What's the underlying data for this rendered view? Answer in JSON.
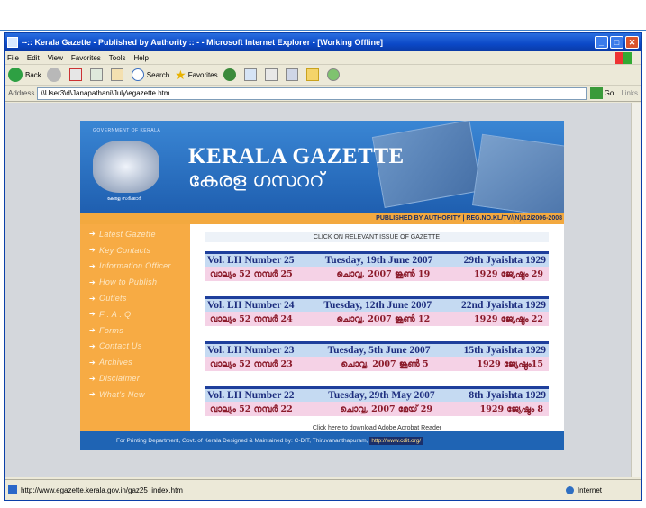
{
  "window": {
    "title": "--:: Kerala Gazette - Published by Authority :: - - Microsoft Internet Explorer - [Working Offline]"
  },
  "menu": [
    "File",
    "Edit",
    "View",
    "Favorites",
    "Tools",
    "Help"
  ],
  "toolbar": {
    "back": "Back",
    "search": "Search",
    "favorites": "Favorites"
  },
  "address": {
    "label": "Address",
    "value": "\\\\User3\\d\\Janapathani\\July\\egazette.htm",
    "go": "Go",
    "links": "Links"
  },
  "page": {
    "gov_label": "GOVERNMENT OF KERALA",
    "emblem_label": "കേരള സർക്കാർ",
    "title": "KERALA GAZETTE",
    "title_ml": "കേരള ഗസററ്",
    "published": "PUBLISHED BY AUTHORITY | REG.NO.KL/TV/(N)/12/2006-2008",
    "instruction": "CLICK ON RELEVANT ISSUE OF GAZETTE",
    "nav": [
      "Latest Gazette",
      "Key Contacts",
      "Information Officer",
      "How to Publish",
      "Outlets",
      "F . A . Q",
      "Forms",
      "Contact Us",
      "Archives",
      "Disclaimer",
      "What's New"
    ],
    "issues": [
      {
        "vol": "Vol. LII  Number 25",
        "date": "Tuesday, 19th June 2007",
        "saka": "29th Jyaishta 1929",
        "vol_ml": "വാല്യം 52 നമ്പർ 25",
        "date_ml": "ചൊവ്വ, 2007 ജൂൺ 19",
        "saka_ml": "1929 ജ്യേഷ്ഠം 29"
      },
      {
        "vol": "Vol. LII  Number 24",
        "date": "Tuesday, 12th June 2007",
        "saka": "22nd Jyaishta 1929",
        "vol_ml": "വാല്യം 52 നമ്പർ 24",
        "date_ml": "ചൊവ്വ, 2007 ജൂൺ 12",
        "saka_ml": "1929 ജ്യേഷ്ഠം 22"
      },
      {
        "vol": "Vol. LII  Number 23",
        "date": "Tuesday, 5th June 2007",
        "saka": "15th Jyaishta 1929",
        "vol_ml": "വാല്യം 52 നമ്പർ 23",
        "date_ml": "ചൊവ്വ, 2007 ജൂൺ 5",
        "saka_ml": "1929 ജ്യേഷ്ഠം15"
      },
      {
        "vol": "Vol. LII  Number 22",
        "date": "Tuesday, 29th May 2007",
        "saka": "8th Jyaishta 1929",
        "vol_ml": "വാല്യം 52 നമ്പർ 22",
        "date_ml": "ചൊവ്വ, 2007 മേയ് 29",
        "saka_ml": "1929 ജ്യേഷ്ഠം 8"
      }
    ],
    "acrobat": "Click here to download Adobe Acrobat Reader",
    "footer": "For Printing Department, Govt. of Kerala Designed & Maintained by: C-DIT, Thiruvananthapuram,",
    "footer_link": "http://www.cdit.org/"
  },
  "status": {
    "url": "http://www.egazette.kerala.gov.in/gaz25_index.htm",
    "zone": "Internet"
  }
}
